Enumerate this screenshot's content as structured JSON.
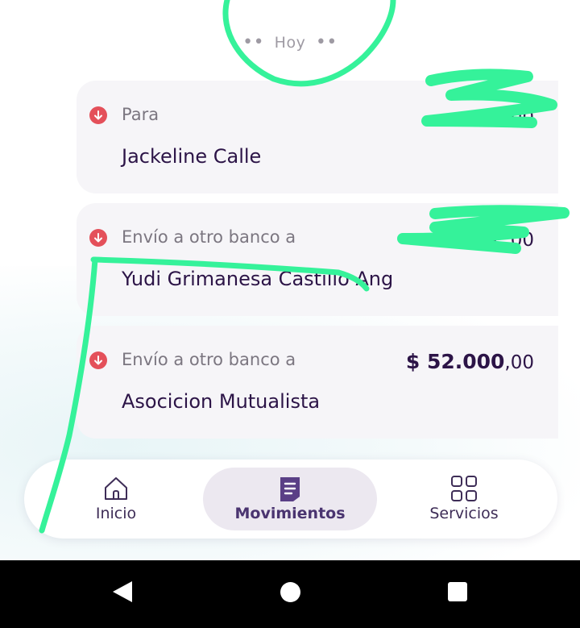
{
  "date_separator": {
    "dots_left": "••",
    "label": "Hoy",
    "dots_right": "••"
  },
  "transactions": [
    {
      "kind": "Para",
      "name": "Jackeline Calle",
      "amount_main": "$ ",
      "amount_cents": ",00",
      "direction_icon": "arrow-down-icon"
    },
    {
      "kind": "Envío a otro banco a",
      "name": "Yudi Grimanesa Castillo Ang",
      "amount_main": "$ ",
      "amount_cents": ",00",
      "direction_icon": "arrow-down-icon"
    },
    {
      "kind": "Envío a otro banco a",
      "name": "Asocicion Mutualista",
      "amount_main": "$ 52.000",
      "amount_cents": ",00",
      "direction_icon": "arrow-down-icon"
    }
  ],
  "bottom_nav": {
    "items": [
      {
        "label": "Inicio",
        "icon": "home-icon",
        "active": false
      },
      {
        "label": "Movimientos",
        "icon": "document-list-icon",
        "active": true
      },
      {
        "label": "Servicios",
        "icon": "grid-icon",
        "active": false
      }
    ]
  },
  "system_nav": {
    "back": "back-icon",
    "home": "home-circle-icon",
    "recents": "recents-icon"
  },
  "colors": {
    "primary_text": "#2c1447",
    "secondary_text": "#7b7680",
    "debit_red": "#e4505a",
    "card_bg": "#f6f5f8",
    "active_nav_bg": "#ece8f0",
    "redaction_marker": "#35f29a"
  }
}
